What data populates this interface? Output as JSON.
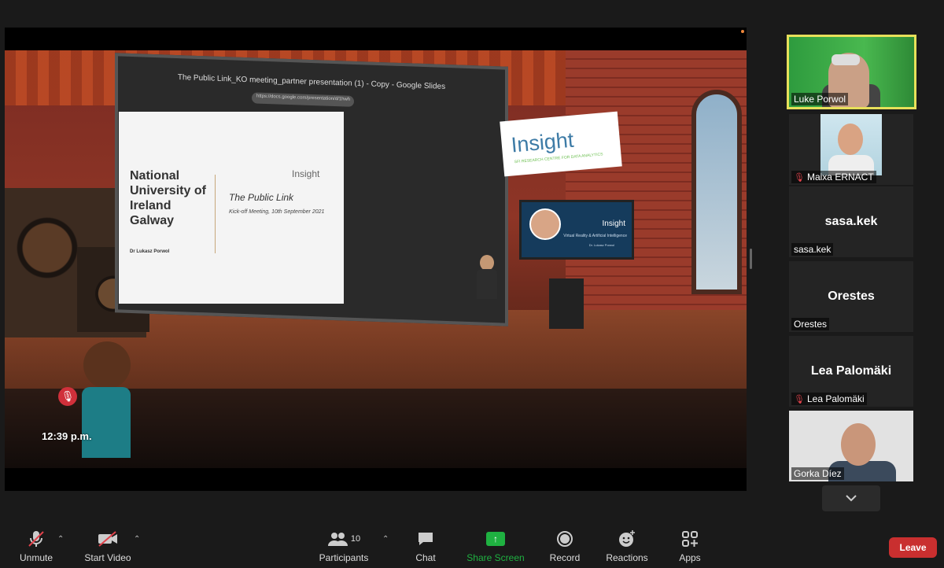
{
  "main": {
    "slide_header": "The Public Link_KO meeting_partner presentation (1) - Copy - Google Slides",
    "slide_url": "https://docs.google.com/presentation/d/1hwh",
    "slide_university": "National University of Ireland Galway",
    "slide_logo": "Insight",
    "slide_title": "The Public Link",
    "slide_subtitle": "Kick-off Meeting, 10th September 2021",
    "slide_author": "Dr Lukasz Porwol",
    "banner_text": "Insight",
    "banner_tag": "SFI RESEARCH CENTRE FOR DATA ANALYTICS",
    "tv_logo": "Insight",
    "tv_line": "Virtual Reality & Artificial Intelligence",
    "tv_line2": "Dr. Lukasz Porwol",
    "clock": "12:39 p.m."
  },
  "participants": [
    {
      "name": "Luke Porwol",
      "video": true,
      "muted": false,
      "active": true
    },
    {
      "name": "Maixa ERNACT",
      "video": true,
      "muted": true,
      "active": false
    },
    {
      "name": "sasa.kek",
      "display": "sasa.kek",
      "video": false,
      "muted": false
    },
    {
      "name": "Orestes",
      "display": "Orestes",
      "video": false,
      "muted": false
    },
    {
      "name": "Lea Palomäki",
      "display": "Lea Palomäki",
      "video": false,
      "muted": true
    },
    {
      "name": "Gorka Díez",
      "video": true,
      "muted": false
    }
  ],
  "toolbar": {
    "unmute": "Unmute",
    "start_video": "Start Video",
    "participants": "Participants",
    "participants_count": "10",
    "chat": "Chat",
    "share_screen": "Share Screen",
    "record": "Record",
    "reactions": "Reactions",
    "apps": "Apps",
    "leave": "Leave"
  },
  "colors": {
    "active_border": "#e7e05a",
    "share_green": "#1fb141",
    "leave_red": "#c92f2f",
    "mute_red": "#e0424b"
  }
}
